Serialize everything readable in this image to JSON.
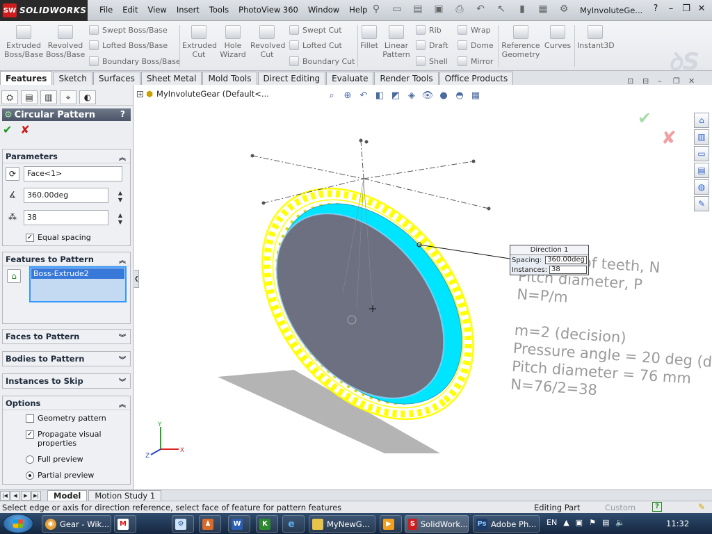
{
  "app": {
    "brand": "SOLIDWORKS",
    "menus": [
      "File",
      "Edit",
      "View",
      "Insert",
      "Tools",
      "PhotoView 360",
      "Window",
      "Help"
    ],
    "doc_title": "MyInvoluteGe..."
  },
  "ribbon": {
    "extruded_boss": "Extruded Boss/Base",
    "revolved_boss": "Revolved Boss/Base",
    "swept_boss": "Swept Boss/Base",
    "lofted_boss": "Lofted Boss/Base",
    "boundary_boss": "Boundary Boss/Base",
    "extruded_cut": "Extruded Cut",
    "hole_wizard": "Hole Wizard",
    "revolved_cut": "Revolved Cut",
    "swept_cut": "Swept Cut",
    "lofted_cut": "Lofted Cut",
    "boundary_cut": "Boundary Cut",
    "fillet": "Fillet",
    "linear_pattern": "Linear Pattern",
    "rib": "Rib",
    "draft": "Draft",
    "shell": "Shell",
    "wrap": "Wrap",
    "dome": "Dome",
    "mirror": "Mirror",
    "reference_geometry": "Reference Geometry",
    "curves": "Curves",
    "instant3d": "Instant3D"
  },
  "tabs": [
    "Features",
    "Sketch",
    "Surfaces",
    "Sheet Metal",
    "Mold Tools",
    "Direct Editing",
    "Evaluate",
    "Render Tools",
    "Office Products"
  ],
  "property_manager": {
    "title": "Circular Pattern",
    "help": "?",
    "parameters": {
      "header": "Parameters",
      "axis": "Face<1>",
      "angle": "360.00deg",
      "instances": "38",
      "equal_spacing_label": "Equal spacing",
      "equal_spacing": true
    },
    "features_to_pattern": {
      "header": "Features to Pattern",
      "items": [
        "Boss-Extrude2"
      ]
    },
    "faces_to_pattern": "Faces to Pattern",
    "bodies_to_pattern": "Bodies to Pattern",
    "instances_to_skip": "Instances to Skip",
    "options": {
      "header": "Options",
      "geometry_pattern": "Geometry pattern",
      "geometry_pattern_checked": false,
      "propagate_visual": "Propagate visual properties",
      "propagate_visual_checked": true,
      "full_preview": "Full preview",
      "partial_preview": "Partial preview",
      "preview_mode": "partial"
    }
  },
  "viewport": {
    "tree_root": "MyInvoluteGear  (Default<...",
    "callout": {
      "title": "Direction 1",
      "spacing_label": "Spacing:",
      "spacing_value": "360.00deg",
      "instances_label": "Instances:",
      "instances_value": "38"
    },
    "notes": [
      "Number of teeth, N",
      "Pitch diameter, P",
      "N=P/m",
      "",
      "m=2 (decision)",
      "Pressure angle = 20 deg (de",
      "Pitch diameter = 76 mm",
      "N=76/2=38"
    ],
    "triad": {
      "x": "X",
      "y": "Y",
      "z": "Z"
    }
  },
  "bottom_tabs": [
    "Model",
    "Motion Study 1"
  ],
  "status": {
    "message": "Select edge or axis for direction reference, select face of feature for pattern features",
    "mode": "Editing Part",
    "config": "Custom"
  },
  "taskbar": {
    "buttons": [
      "Gear - Wik...",
      "",
      "",
      "",
      "",
      "",
      "",
      "MyNewG...",
      "",
      "SolidWork...",
      "Adobe Ph..."
    ],
    "language": "EN",
    "time": "11:32"
  },
  "colors": {
    "preview_yellow": "#ffff00",
    "face_cyan": "#00e5ff",
    "body_grey": "#6d7080",
    "ok_green": "#1d9a1d",
    "cancel_red": "#d01818"
  }
}
